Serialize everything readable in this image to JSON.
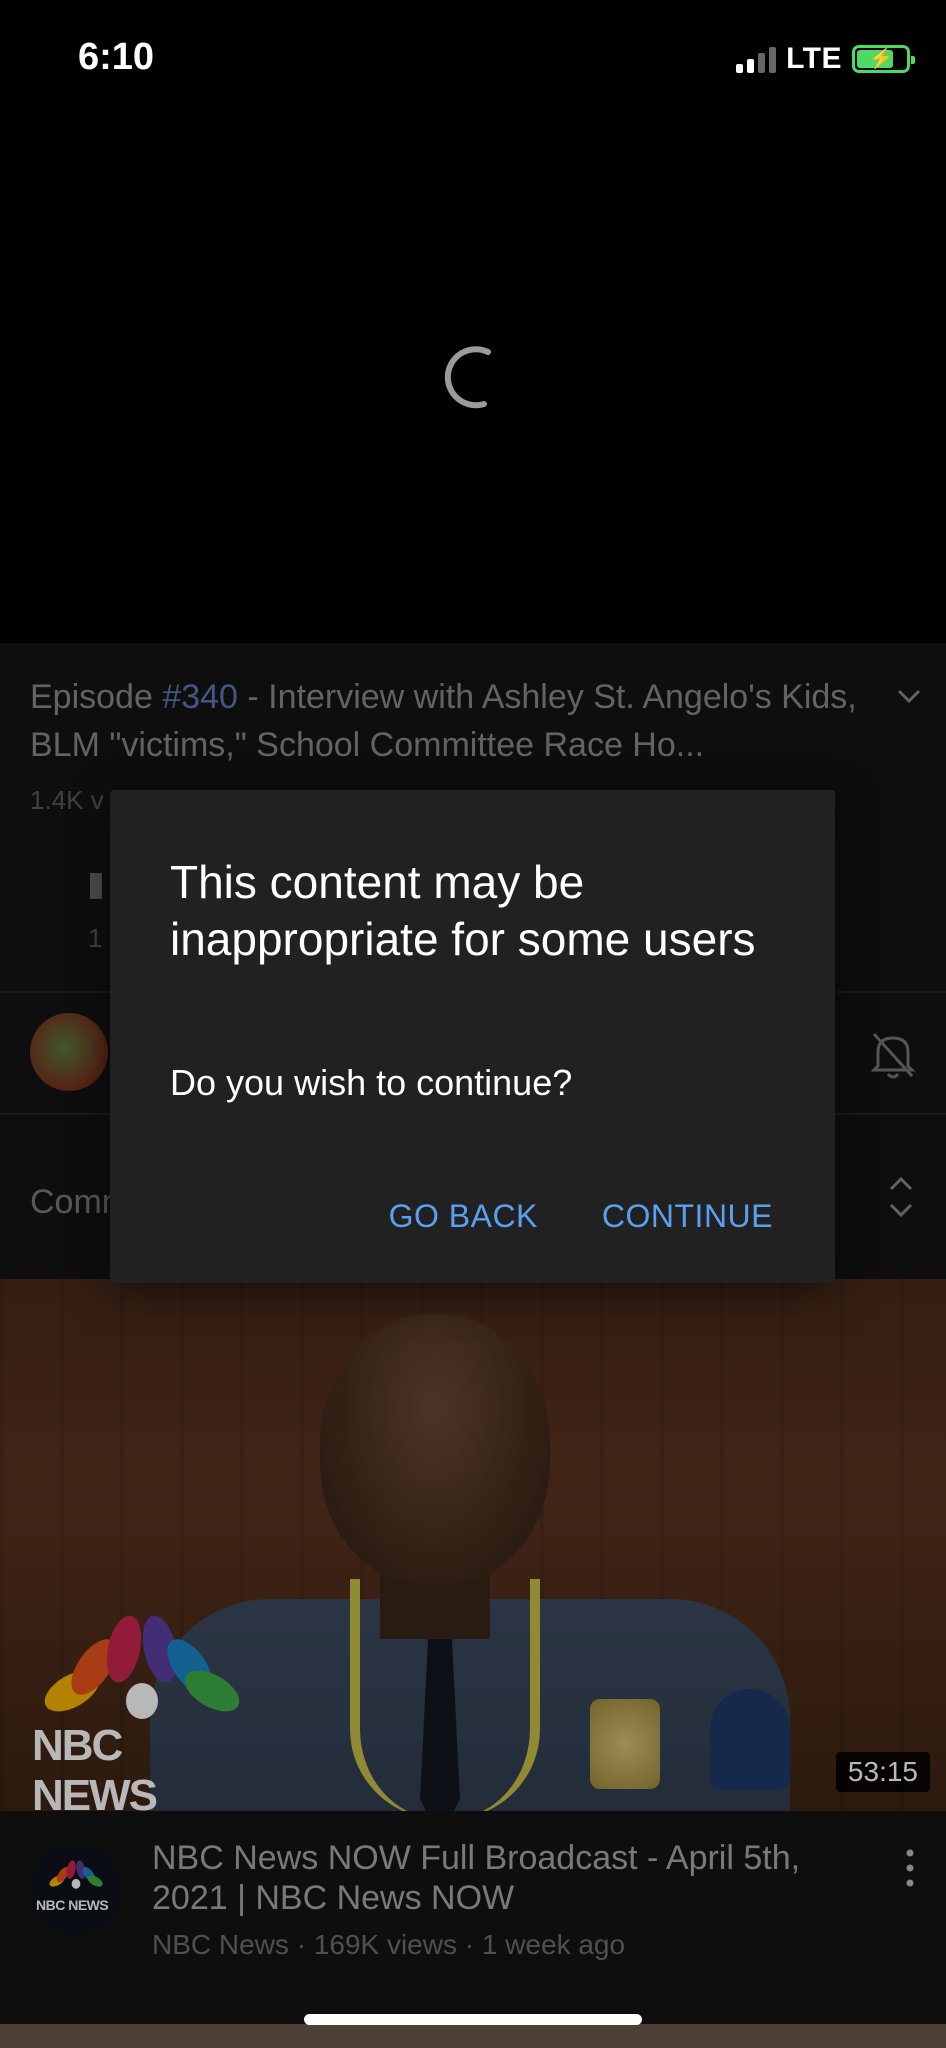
{
  "status_bar": {
    "time": "6:10",
    "network": "LTE",
    "icons": [
      "signal-icon",
      "battery-charging-icon"
    ]
  },
  "player": {
    "state": "loading",
    "icon": "loading-spinner-icon"
  },
  "video": {
    "title_prefix": "Episode ",
    "title_hashtag": "#340",
    "title_rest": " - Interview with Ashley St. Angelo's Kids, BLM \"victims,\" School Committee Race Ho...",
    "views_partial": "1.4K v",
    "like_count_partial": "1",
    "comments_partial": "Comm"
  },
  "dialog": {
    "title": "This content may be inappropriate for some users",
    "body": "Do you wish to continue?",
    "go_back_label": "GO BACK",
    "continue_label": "CONTINUE"
  },
  "next_video": {
    "logo_text": "NBC NEWS",
    "duration": "53:15",
    "avatar_text": "NBC NEWS",
    "title": "NBC News NOW Full Broadcast - April 5th, 2021 | NBC News NOW",
    "meta": "NBC News · 169K views · 1 week ago"
  },
  "colors": {
    "accent_blue": "#5aa0f2",
    "hashtag_blue": "#5b7bb5",
    "battery_green": "#4cd964",
    "dialog_bg": "#212121"
  }
}
